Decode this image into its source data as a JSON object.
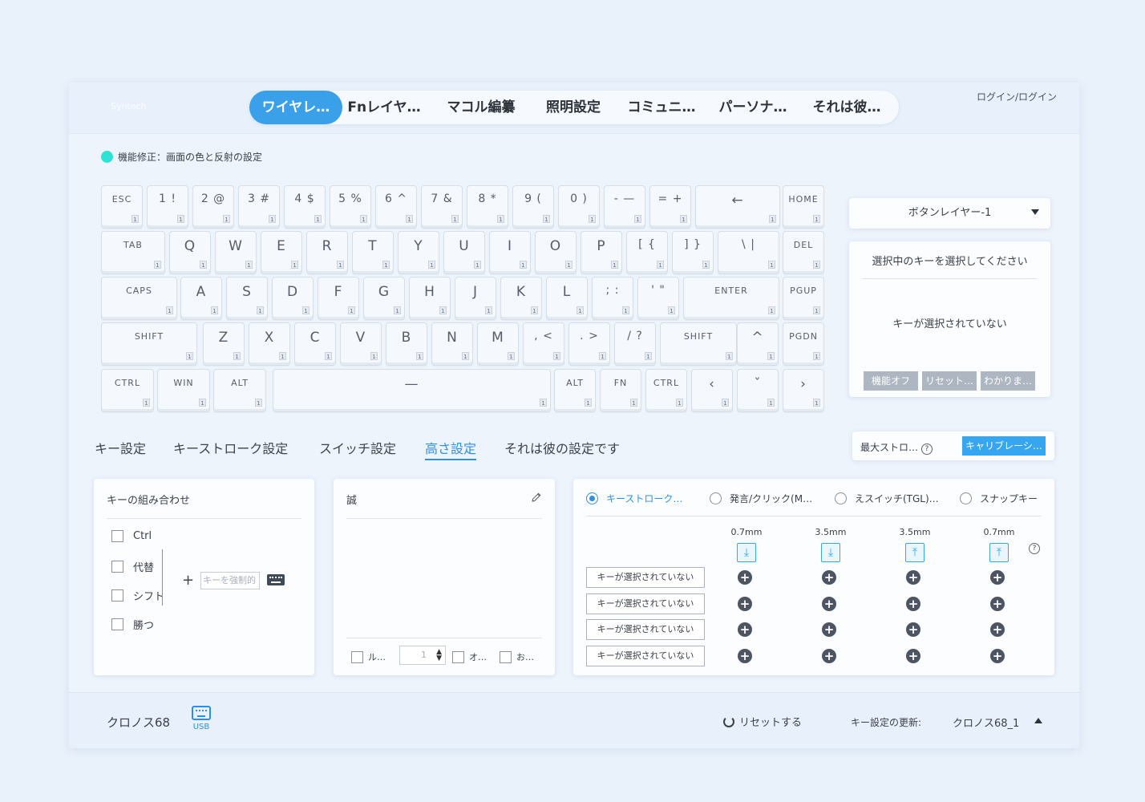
{
  "header": {
    "brand": "Syntech",
    "tabs": [
      "ワイヤレ…",
      "Fnレイヤ…",
      "マコル編纂",
      "照明設定",
      "コミュニ…",
      "パーソナ…",
      "それは彼…"
    ],
    "login": "ログイン/ログイン"
  },
  "notice": "機能修正：画面の色と反射の設定",
  "keyboard": {
    "layer_number": "1",
    "rows": [
      [
        "ESC",
        "1 !",
        "2 @",
        "3 #",
        "4 $",
        "5 %",
        "6 ^",
        "7 &",
        "8 *",
        "9 (",
        "0 )",
        "- —",
        "= +",
        "←",
        "HOME"
      ],
      [
        "TAB",
        "Q",
        "W",
        "E",
        "R",
        "T",
        "Y",
        "U",
        "I",
        "O",
        "P",
        "[ {",
        "] }",
        "\\ |",
        "DEL"
      ],
      [
        "CAPS",
        "A",
        "S",
        "D",
        "F",
        "G",
        "H",
        "J",
        "K",
        "L",
        "; :",
        "' \"",
        "ENTER",
        "PGUP"
      ],
      [
        "SHIFT",
        "Z",
        "X",
        "C",
        "V",
        "B",
        "N",
        "M",
        ", <",
        ". >",
        "/ ?",
        "SHIFT",
        "^",
        "PGDN"
      ],
      [
        "CTRL",
        "WIN",
        "ALT",
        "—",
        "ALT",
        "FN",
        "CTRL",
        "‹",
        "ˇ",
        "›"
      ]
    ]
  },
  "side": {
    "layer_select": "ボタンレイヤー-1",
    "key_title": "選択中のキーを選択してください",
    "key_empty": "キーが選択されていない",
    "buttons": [
      "機能オフ",
      "リセット…",
      "わかりま…"
    ]
  },
  "subtabs": [
    "キー設定",
    "キーストローク設定",
    "スイッチ設定",
    "高さ設定",
    "それは彼の設定です"
  ],
  "stroke_bar": {
    "label": "最大ストロ…",
    "help": "?",
    "calibrate": "キャリブレーシ…"
  },
  "combo": {
    "title": "キーの組み合わせ",
    "options": [
      "Ctrl",
      "代替",
      "シフト",
      "勝つ"
    ],
    "plus": "+",
    "key_placeholder": "キーを強制的"
  },
  "macro": {
    "title": "誠",
    "opt1": "ル…",
    "spin_value": "1",
    "opt2": "オ…",
    "opt3": "お…"
  },
  "travel": {
    "modes": [
      "キーストローク…",
      "発言/クリック(M…",
      "えスイッチ(TGL)…",
      "スナップキー"
    ],
    "depths": [
      "0.7mm",
      "3.5mm",
      "3.5mm",
      "0.7mm"
    ],
    "rows": [
      "キーが選択されていない",
      "キーが選択されていない",
      "キーが選択されていない",
      "キーが選択されていない"
    ],
    "help": "?"
  },
  "footer": {
    "device": "クロノス68",
    "usb": "USB",
    "reset": "リセットする",
    "update_label": "キー設定の更新:",
    "config": "クロノス68_1"
  }
}
